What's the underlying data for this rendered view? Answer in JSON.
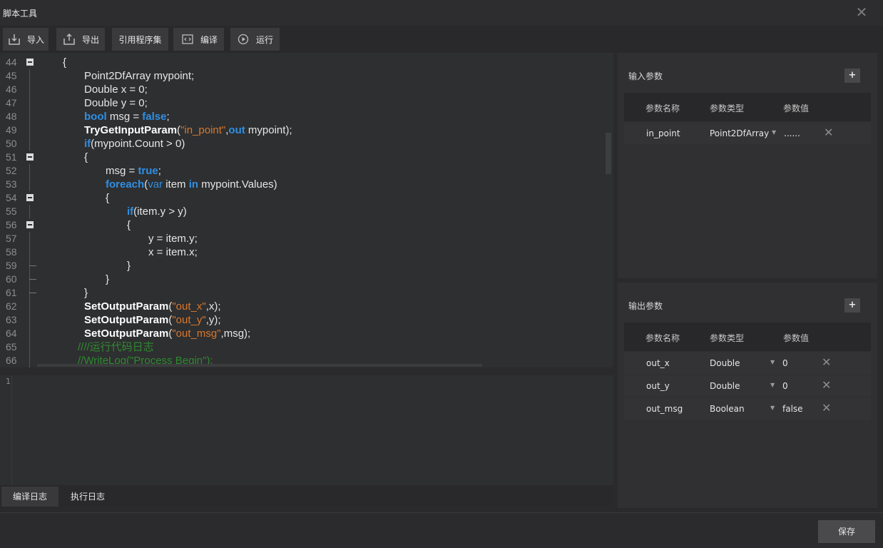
{
  "window": {
    "title": "脚本工具",
    "close_icon": "close-icon"
  },
  "toolbar": {
    "buttons": [
      {
        "label": "导入",
        "icon": "import-icon"
      },
      {
        "label": "导出",
        "icon": "export-icon"
      },
      {
        "label": "引用程序集",
        "icon": ""
      },
      {
        "label": "编译",
        "icon": "code-icon"
      },
      {
        "label": "运行",
        "icon": "play-icon"
      }
    ]
  },
  "editor": {
    "lines": [
      {
        "n": "44",
        "fold": "box",
        "indent": 0,
        "tokens": [
          [
            "p",
            "{"
          ]
        ]
      },
      {
        "n": "45",
        "fold": "line",
        "indent": 1,
        "tokens": [
          [
            "p",
            "Point2DfArray mypoint;"
          ]
        ]
      },
      {
        "n": "46",
        "fold": "line",
        "indent": 1,
        "tokens": [
          [
            "p",
            "Double x = 0;"
          ]
        ]
      },
      {
        "n": "47",
        "fold": "line",
        "indent": 1,
        "tokens": [
          [
            "p",
            "Double y = 0;"
          ]
        ]
      },
      {
        "n": "48",
        "fold": "line",
        "indent": 1,
        "tokens": [
          [
            "kwb",
            "bool"
          ],
          [
            "p",
            " msg = "
          ],
          [
            "kwb",
            "false"
          ],
          [
            "p",
            ";"
          ]
        ]
      },
      {
        "n": "49",
        "fold": "line",
        "indent": 1,
        "tokens": [
          [
            "fn",
            "TryGetInputParam"
          ],
          [
            "p",
            "("
          ],
          [
            "str",
            "\"in_point\""
          ],
          [
            "p",
            ","
          ],
          [
            "kwb",
            "out"
          ],
          [
            "p",
            " mypoint);"
          ]
        ]
      },
      {
        "n": "50",
        "fold": "line",
        "indent": 1,
        "tokens": [
          [
            "kwb",
            "if"
          ],
          [
            "p",
            "(mypoint.Count > 0)"
          ]
        ]
      },
      {
        "n": "51",
        "fold": "box",
        "indent": 1,
        "tokens": [
          [
            "p",
            "{"
          ]
        ]
      },
      {
        "n": "52",
        "fold": "line",
        "indent": 2,
        "tokens": [
          [
            "p",
            "msg = "
          ],
          [
            "kwb",
            "true"
          ],
          [
            "p",
            ";"
          ]
        ]
      },
      {
        "n": "53",
        "fold": "line",
        "indent": 2,
        "tokens": [
          [
            "kwb",
            "foreach"
          ],
          [
            "p",
            "("
          ],
          [
            "kw",
            "var"
          ],
          [
            "p",
            " item "
          ],
          [
            "kwb",
            "in"
          ],
          [
            "p",
            " mypoint.Values)"
          ]
        ]
      },
      {
        "n": "54",
        "fold": "box",
        "indent": 2,
        "tokens": [
          [
            "p",
            "{"
          ]
        ]
      },
      {
        "n": "55",
        "fold": "line",
        "indent": 3,
        "tokens": [
          [
            "kwb",
            "if"
          ],
          [
            "p",
            "(item.y > y)"
          ]
        ]
      },
      {
        "n": "56",
        "fold": "box",
        "indent": 3,
        "tokens": [
          [
            "p",
            "{"
          ]
        ]
      },
      {
        "n": "57",
        "fold": "line",
        "indent": 4,
        "tokens": [
          [
            "p",
            "y = item.y;"
          ]
        ]
      },
      {
        "n": "58",
        "fold": "line",
        "indent": 4,
        "tokens": [
          [
            "p",
            "x = item.x;"
          ]
        ]
      },
      {
        "n": "59",
        "fold": "end",
        "indent": 3,
        "tokens": [
          [
            "p",
            "}"
          ]
        ]
      },
      {
        "n": "60",
        "fold": "end",
        "indent": 2,
        "tokens": [
          [
            "p",
            "}"
          ]
        ]
      },
      {
        "n": "61",
        "fold": "end",
        "indent": 1,
        "tokens": [
          [
            "p",
            "}"
          ]
        ]
      },
      {
        "n": "62",
        "fold": "line",
        "indent": 1,
        "tokens": [
          [
            "fn",
            "SetOutputParam"
          ],
          [
            "p",
            "("
          ],
          [
            "str",
            "\"out_x\""
          ],
          [
            "p",
            ",x);"
          ]
        ]
      },
      {
        "n": "63",
        "fold": "line",
        "indent": 1,
        "tokens": [
          [
            "fn",
            "SetOutputParam"
          ],
          [
            "p",
            "("
          ],
          [
            "str",
            "\"out_y\""
          ],
          [
            "p",
            ",y);"
          ]
        ]
      },
      {
        "n": "64",
        "fold": "line",
        "indent": 1,
        "tokens": [
          [
            "fn",
            "SetOutputParam"
          ],
          [
            "p",
            "("
          ],
          [
            "str",
            "\"out_msg\""
          ],
          [
            "p",
            ",msg);"
          ]
        ]
      },
      {
        "n": "65",
        "fold": "line",
        "indent": 0.7,
        "tokens": [
          [
            "cm",
            "////运行代码日志"
          ]
        ]
      },
      {
        "n": "66",
        "fold": "line",
        "indent": 0.7,
        "tokens": [
          [
            "cm",
            "//WriteLog(\"Process Begin\");"
          ]
        ]
      }
    ]
  },
  "log": {
    "line_number": "1"
  },
  "log_tabs": [
    {
      "label": "编译日志",
      "active": true
    },
    {
      "label": "执行日志",
      "active": false
    }
  ],
  "input_params": {
    "title": "输入参数",
    "add_label": "+",
    "headers": [
      "参数名称",
      "参数类型",
      "参数值"
    ],
    "rows": [
      {
        "name": "in_point",
        "type": "Point2DfArray",
        "value": "......"
      }
    ]
  },
  "output_params": {
    "title": "输出参数",
    "add_label": "+",
    "headers": [
      "参数名称",
      "参数类型",
      "参数值"
    ],
    "rows": [
      {
        "name": "out_x",
        "type": "Double",
        "value": "0"
      },
      {
        "name": "out_y",
        "type": "Double",
        "value": "0"
      },
      {
        "name": "out_msg",
        "type": "Boolean",
        "value": "false"
      }
    ]
  },
  "footer": {
    "save_label": "保存"
  },
  "colors": {
    "keyword": "#2f8fe3",
    "string": "#d8782d",
    "comment": "#2e8b2e",
    "background": "#2a2a2c"
  }
}
